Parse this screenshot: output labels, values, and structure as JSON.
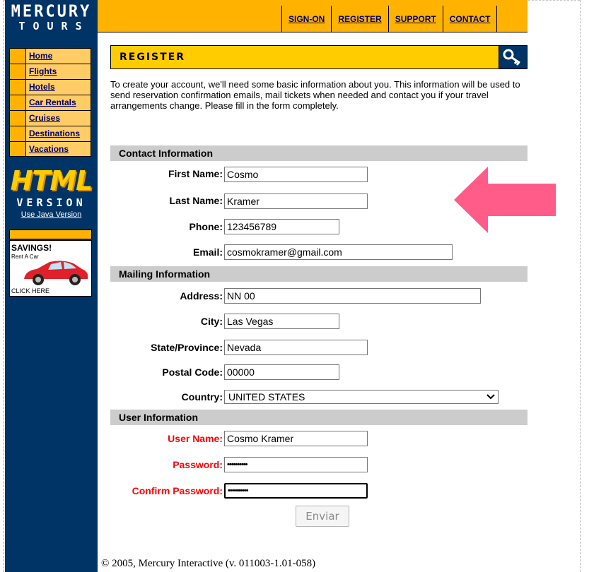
{
  "logo": {
    "line1": "MERCURY",
    "line2": "TOURS"
  },
  "top_nav": [
    "SIGN-ON",
    "REGISTER",
    "SUPPORT",
    "CONTACT"
  ],
  "side_nav": [
    "Home",
    "Flights",
    "Hotels",
    "Car Rentals",
    "Cruises",
    "Destinations",
    "Vacations"
  ],
  "html_badge": {
    "html": "HTML",
    "version": "VERSION",
    "java_link": "Use Java Version"
  },
  "ad": {
    "title": "SAVINGS!",
    "subtitle": "Rent A Car",
    "cta": "CLICK HERE"
  },
  "register": {
    "title": "REGISTER",
    "intro": "To create your account, we'll need some basic information about you. This information will be used to send reservation confirmation emails, mail tickets when needed and contact you if your travel arrangements change. Please fill in the form completely."
  },
  "form": {
    "contact_section": "Contact Information",
    "first_name": {
      "label": "First Name:",
      "value": "Cosmo"
    },
    "last_name": {
      "label": "Last Name:",
      "value": "Kramer"
    },
    "phone": {
      "label": "Phone:",
      "value": "123456789"
    },
    "email": {
      "label": "Email:",
      "value": "cosmokramer@gmail.com"
    },
    "mailing_section": "Mailing Information",
    "address": {
      "label": "Address:",
      "value": "NN 00"
    },
    "city": {
      "label": "City:",
      "value": "Las Vegas"
    },
    "state": {
      "label": "State/Province:",
      "value": "Nevada"
    },
    "postal": {
      "label": "Postal Code:",
      "value": "00000"
    },
    "country": {
      "label": "Country:",
      "value": "UNITED STATES"
    },
    "user_section": "User Information",
    "user_name": {
      "label": "User Name:",
      "value": "Cosmo Kramer"
    },
    "password": {
      "label": "Password:",
      "value": "••••••••••"
    },
    "confirm_password": {
      "label": "Confirm Password:",
      "value": "••••••••••"
    },
    "submit": "Enviar"
  },
  "footer": "© 2005, Mercury Interactive (v. 011003-1.01-058)",
  "colors": {
    "navy": "#003366",
    "orange": "#ffb300",
    "yellow": "#ffcc00",
    "section_gray": "#cccccc",
    "required_red": "#ff0000",
    "arrow_pink": "#ff5c8a"
  }
}
